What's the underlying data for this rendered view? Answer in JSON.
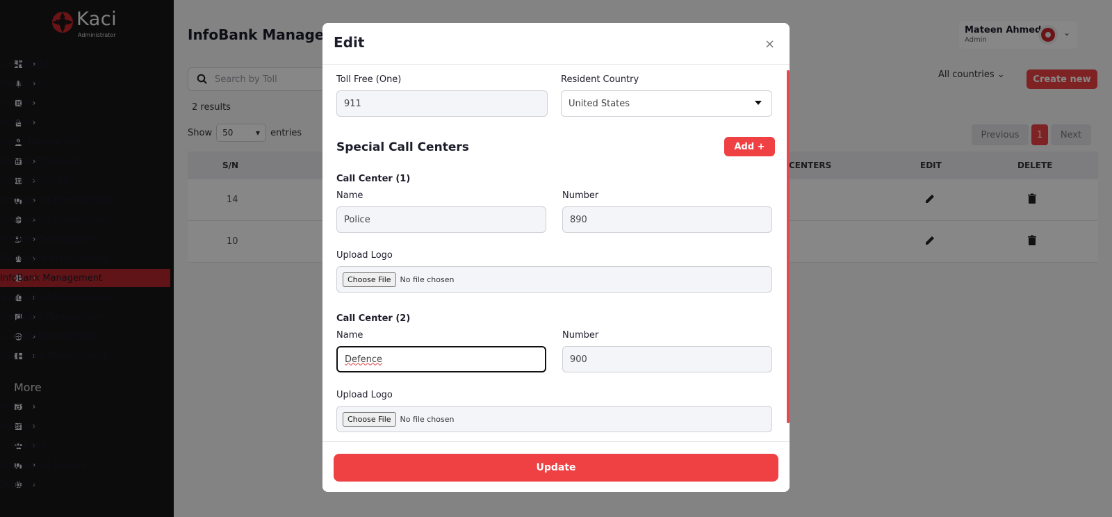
{
  "brand": {
    "name": "Kaci",
    "subtitle": "Administrator",
    "accent": "#ef4043"
  },
  "sidebar": {
    "items": [
      {
        "label": "Dashboard",
        "icon": "dashboard-icon",
        "chevron": true
      },
      {
        "label": "Notifications",
        "icon": "bell-icon",
        "chevron": true
      },
      {
        "label": "Notices",
        "icon": "notice-icon",
        "chevron": true
      },
      {
        "label": "Access",
        "icon": "lock-icon",
        "chevron": true
      },
      {
        "label": "Users Management",
        "icon": "user-icon",
        "chevron": false
      },
      {
        "label": "Banner Promotion",
        "icon": "banner-icon",
        "chevron": true
      },
      {
        "label": "Popup Promotion",
        "icon": "popup-icon",
        "chevron": true
      },
      {
        "label": "Ambulance Management",
        "icon": "ambulance-icon",
        "chevron": true
      },
      {
        "label": "Emergency Management",
        "icon": "emergency-icon",
        "chevron": true
      },
      {
        "label": "iReport Management",
        "icon": "report-icon",
        "chevron": true
      },
      {
        "label": "TravelSafe Management",
        "icon": "travel-icon",
        "chevron": true
      },
      {
        "label": "InfoBank Management",
        "icon": "info-icon",
        "chevron": true,
        "active": true
      },
      {
        "label": "Suggestion Management",
        "icon": "suggestion-icon",
        "chevron": true
      },
      {
        "label": "Feedback Management",
        "icon": "feedback-icon",
        "chevron": true
      },
      {
        "label": "Climate Management",
        "icon": "climate-icon",
        "chevron": true
      },
      {
        "label": "Kaci Code Management",
        "icon": "code-icon",
        "chevron": true
      }
    ],
    "more_heading": "More",
    "more_items": [
      {
        "label": "Areas",
        "icon": "map-icon"
      },
      {
        "label": "Agencies",
        "icon": "building-icon"
      },
      {
        "label": "Help Book",
        "icon": "people-icon"
      },
      {
        "label": "Ambulance Service",
        "icon": "ambulance-icon"
      },
      {
        "label": "Settings",
        "icon": "gear-icon"
      }
    ]
  },
  "header": {
    "title": "InfoBank Management",
    "user_name": "Mateen Ahmed",
    "user_role": "Admin"
  },
  "toolbar": {
    "search_placeholder": "Search by Toll",
    "results": "2 results",
    "show_label": "Show",
    "entries_value": "50",
    "entries_label": "entries",
    "country_filter": "All countries",
    "create_label": "Create new"
  },
  "pagination": {
    "previous": "Previous",
    "current": "1",
    "next": "Next"
  },
  "table": {
    "columns": {
      "sn": "S/N",
      "centers": "CENTERS",
      "edit": "EDIT",
      "delete": "DELETE"
    },
    "rows": [
      {
        "sn": "14"
      },
      {
        "sn": "10"
      }
    ]
  },
  "modal": {
    "title": "Edit",
    "toll_free_label": "Toll Free (One)",
    "toll_free_value": "911",
    "country_label": "Resident Country",
    "country_value": "United States",
    "section_title": "Special Call Centers",
    "add_label": "Add +",
    "centers": [
      {
        "heading": "Call Center (1)",
        "name_label": "Name",
        "name_value": "Police",
        "number_label": "Number",
        "number_value": "890",
        "logo_label": "Upload Logo",
        "choose_label": "Choose File",
        "file_status": "No file chosen"
      },
      {
        "heading": "Call Center (2)",
        "name_label": "Name",
        "name_value": "Defence",
        "number_label": "Number",
        "number_value": "900",
        "logo_label": "Upload Logo",
        "choose_label": "Choose File",
        "file_status": "No file chosen"
      }
    ],
    "update_label": "Update"
  }
}
